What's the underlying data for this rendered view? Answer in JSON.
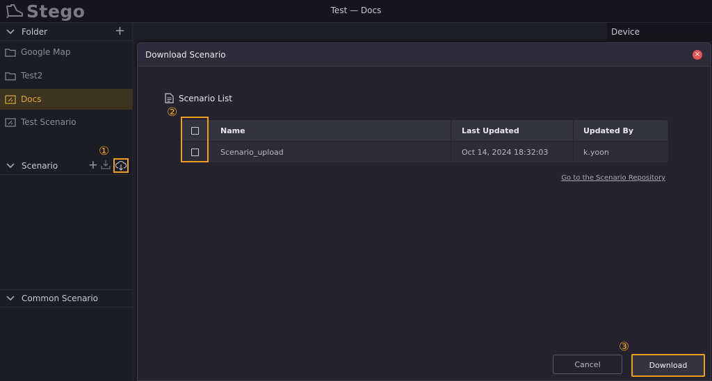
{
  "app": {
    "logo_text": "Stego",
    "window_title": "Test — Docs"
  },
  "sidebar": {
    "folder_header": "Folder",
    "folders": [
      {
        "label": "Google Map",
        "active": false
      },
      {
        "label": "Test2",
        "active": false
      },
      {
        "label": "Docs",
        "active": true
      },
      {
        "label": "Test Scenario",
        "active": false
      }
    ],
    "scenario_header": "Scenario",
    "common_header": "Common Scenario"
  },
  "device_tab": "Device",
  "modal": {
    "title": "Download Scenario",
    "list_title": "Scenario List",
    "columns": {
      "name": "Name",
      "last_updated": "Last Updated",
      "updated_by": "Updated By"
    },
    "rows": [
      {
        "name": "Scenario_upload",
        "last_updated": "Oct 14, 2024 18:32:03",
        "updated_by": "k.yoon"
      }
    ],
    "repo_link": "Go to the Scenario Repository",
    "cancel_label": "Cancel",
    "download_label": "Download"
  },
  "markers": {
    "one": "①",
    "two": "②",
    "three": "③"
  },
  "colors": {
    "accent": "#f0a020",
    "active_folder_bg": "#3c3420",
    "close": "#e25555"
  }
}
